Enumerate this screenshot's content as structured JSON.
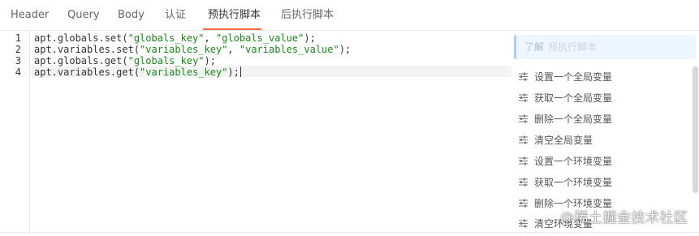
{
  "tabs": [
    {
      "label": "Header",
      "active": false
    },
    {
      "label": "Query",
      "active": false
    },
    {
      "label": "Body",
      "active": false
    },
    {
      "label": "认证",
      "active": false
    },
    {
      "label": "预执行脚本",
      "active": true
    },
    {
      "label": "后执行脚本",
      "active": false
    }
  ],
  "accent_color": "#f26a3d",
  "editor": {
    "line_numbers": [
      "1",
      "2",
      "3",
      "4"
    ],
    "lines": [
      {
        "prefix": "apt.globals.set(",
        "s1": "\"globals_key\"",
        "mid": ", ",
        "s2": "\"globals_value\"",
        "suffix": ");"
      },
      {
        "prefix": "apt.variables.set(",
        "s1": "\"variables_key\"",
        "mid": ", ",
        "s2": "\"variables_value\"",
        "suffix": ");"
      },
      {
        "prefix": "apt.globals.get(",
        "s1": "\"globals_key\"",
        "mid": "",
        "s2": "",
        "suffix": ");"
      },
      {
        "prefix": "apt.variables.get(",
        "s1": "\"variables_key\"",
        "mid": "",
        "s2": "",
        "suffix": ");"
      }
    ],
    "string_color": "#1a8a1a"
  },
  "panel": {
    "info_link": "了解",
    "info_text": "预执行脚本",
    "snippet_icon": "sliders-icon",
    "snippets": [
      "设置一个全局变量",
      "获取一个全局变量",
      "删除一个全局变量",
      "清空全局变量",
      "设置一个环境变量",
      "获取一个环境变量",
      "删除一个环境变量",
      "清空环境变量"
    ]
  },
  "watermark": "@稀土掘金技术社区"
}
